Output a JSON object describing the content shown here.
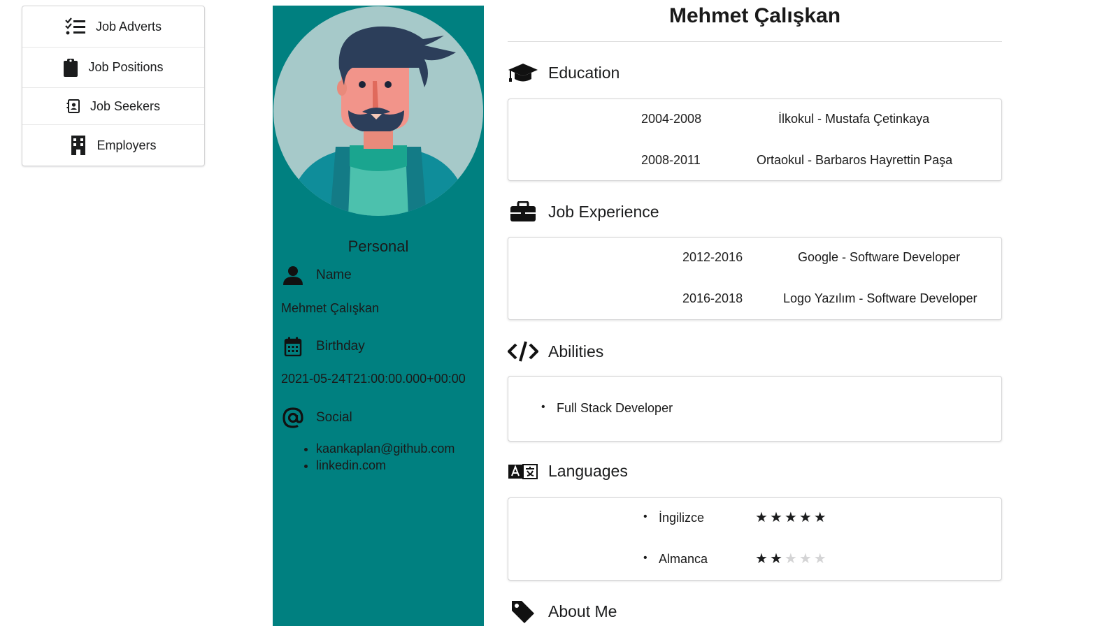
{
  "nav": {
    "items": [
      {
        "label": "Job Adverts",
        "icon": "tasks-icon"
      },
      {
        "label": "Job Positions",
        "icon": "clipboard-icon"
      },
      {
        "label": "Job Seekers",
        "icon": "address-book-icon"
      },
      {
        "label": "Employers",
        "icon": "building-icon"
      }
    ]
  },
  "personal": {
    "title": "Personal",
    "name_label": "Name",
    "name_value": "Mehmet Çalışkan",
    "birthday_label": "Birthday",
    "birthday_value": "2021-05-24T21:00:00.000+00:00",
    "social_label": "Social",
    "social": [
      "kaankaplan@github.com",
      "linkedin.com"
    ],
    "accent_color": "#008080"
  },
  "cv": {
    "full_name": "Mehmet Çalışkan",
    "education": {
      "title": "Education",
      "rows": [
        {
          "years": "2004-2008",
          "school": "İlkokul - Mustafa Çetinkaya"
        },
        {
          "years": "2008-2011",
          "school": "Ortaokul - Barbaros Hayrettin Paşa"
        }
      ]
    },
    "experience": {
      "title": "Job Experience",
      "rows": [
        {
          "years": "2012-2016",
          "job": "Google - Software Developer"
        },
        {
          "years": "2016-2018",
          "job": "Logo Yazılım - Software Developer"
        }
      ]
    },
    "abilities": {
      "title": "Abilities",
      "items": [
        "Full Stack Developer"
      ]
    },
    "languages": {
      "title": "Languages",
      "items": [
        {
          "name": "İngilizce",
          "level": 5,
          "max": 5
        },
        {
          "name": "Almanca",
          "level": 2,
          "max": 5
        }
      ]
    },
    "about": {
      "title": "About Me"
    }
  }
}
